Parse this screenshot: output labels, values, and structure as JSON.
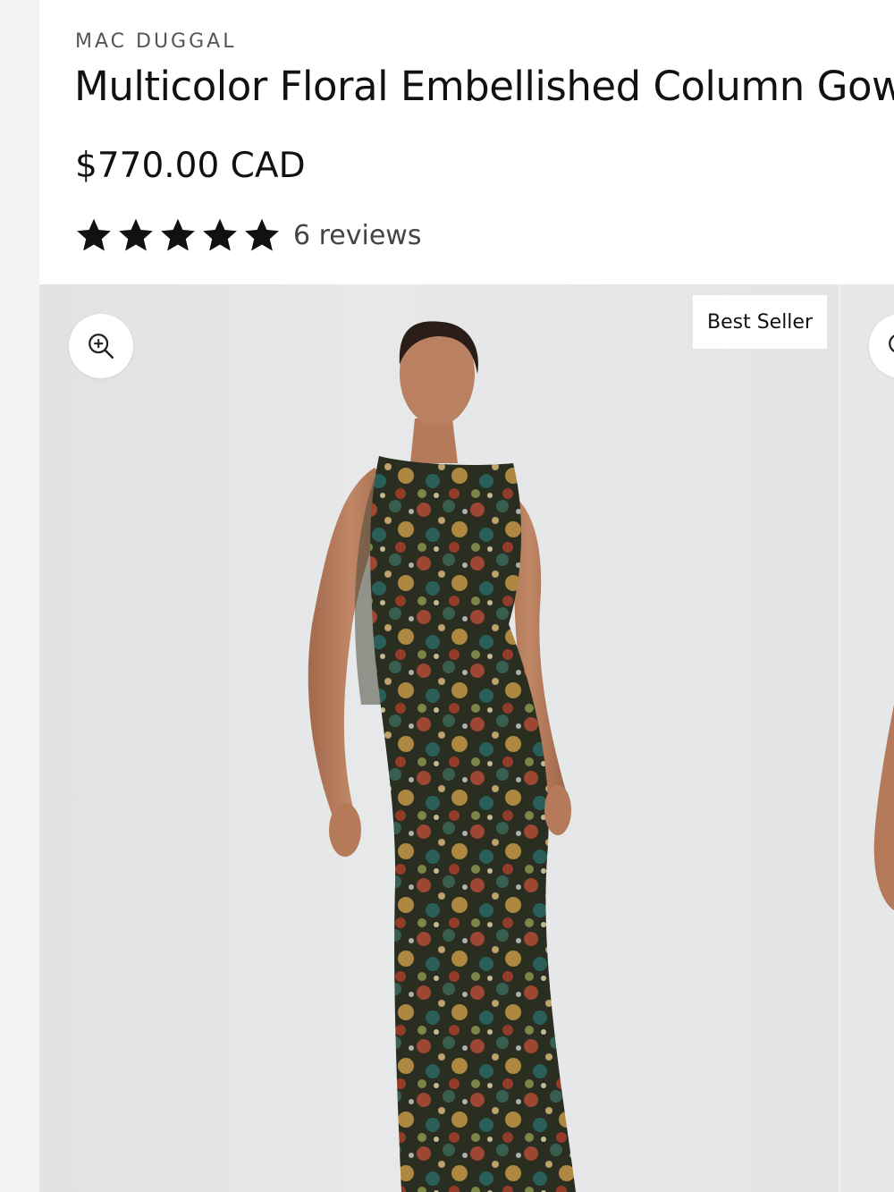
{
  "product": {
    "brand": "MAC DUGGAL",
    "title": "Multicolor Floral Embellished Column Gown",
    "price": "$770.00 CAD",
    "rating": {
      "stars": 5,
      "max": 5,
      "reviews_label": "6 reviews"
    }
  },
  "gallery": {
    "badge": "Best Seller",
    "zoom_icon": "zoom-in-icon",
    "image": "model-wearing-floral-gown"
  },
  "colors": {
    "text": "#111111",
    "muted": "#555555",
    "image_bg": "#e4e5e6",
    "gown_base": "#3a3a2a"
  }
}
